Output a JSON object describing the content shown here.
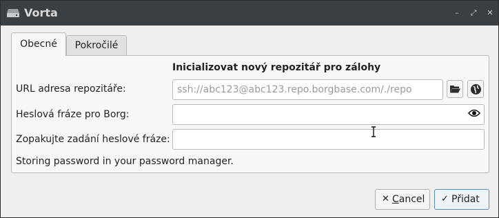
{
  "window": {
    "title": "Vorta",
    "minimize": "–",
    "maximize": "⤢",
    "close": "✕"
  },
  "tabs": [
    {
      "label": "Obecné",
      "active": true
    },
    {
      "label": "Pokročilé",
      "active": false
    }
  ],
  "form": {
    "heading": "Inicializovat nový repozitář pro zálohy",
    "url_label": "URL adresa repozitáře:",
    "url_placeholder": "ssh://abc123@abc123.repo.borgbase.com/./repo",
    "url_value": "",
    "passphrase_label": "Heslová fráze pro Borg:",
    "passphrase_value": "",
    "repeat_label": "Zopakujte zadání heslové fráze:",
    "repeat_value": "",
    "status_text": "Storing password in your password manager."
  },
  "icons": {
    "app": "hard-drive-icon",
    "browse": "folder-open-icon",
    "remote": "globe-icon",
    "reveal": "eye-icon"
  },
  "buttons": {
    "cancel_label": "Cancel",
    "cancel_mnemonic": "C",
    "cancel_rest": "ancel",
    "cancel_glyph": "✕",
    "add_label": "Přidat",
    "add_glyph": "✓"
  },
  "colors": {
    "titlebar": "#3a3f43",
    "window_bg": "#efefef",
    "panel_bg": "#f8f8f8",
    "accent_border": "#5b8ec2"
  }
}
